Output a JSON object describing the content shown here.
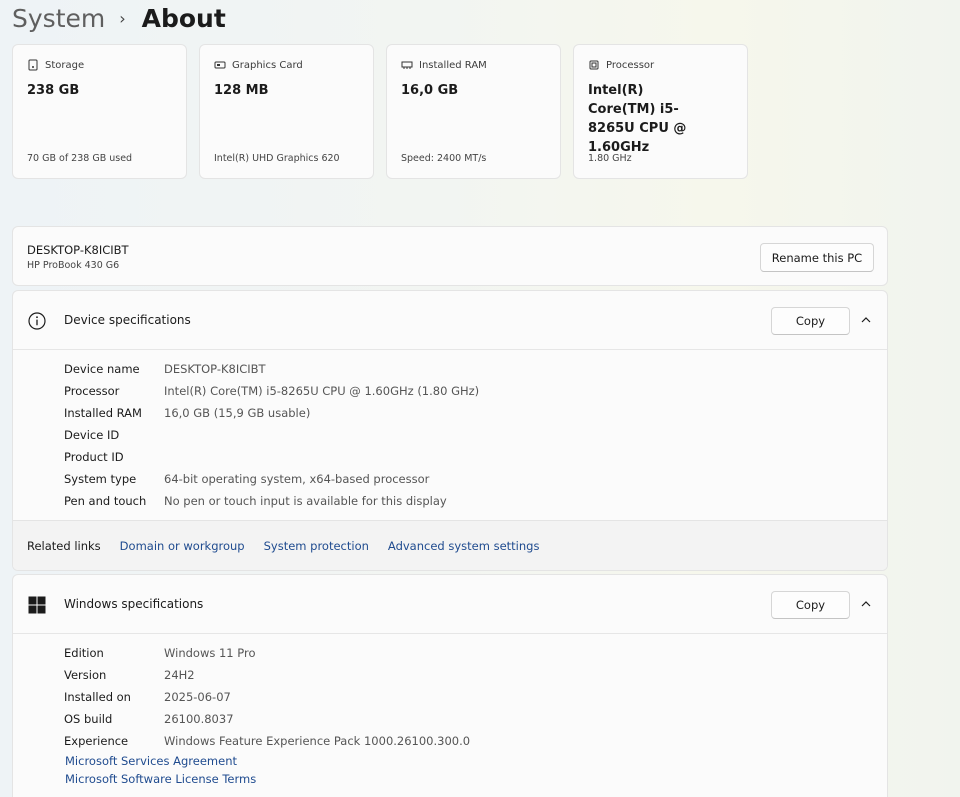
{
  "breadcrumb": {
    "parent": "System",
    "separator": "›",
    "current": "About"
  },
  "cards": [
    {
      "icon": "storage-icon",
      "label": "Storage",
      "value": "238 GB",
      "sub": "70 GB of 238 GB used"
    },
    {
      "icon": "graphics-card-icon",
      "label": "Graphics Card",
      "value": "128 MB",
      "sub": "Intel(R) UHD Graphics 620"
    },
    {
      "icon": "ram-icon",
      "label": "Installed RAM",
      "value": "16,0 GB",
      "sub": "Speed: 2400 MT/s"
    },
    {
      "icon": "processor-icon",
      "label": "Processor",
      "value": "Intel(R) Core(TM) i5-8265U CPU @ 1.60GHz",
      "sub": "1.80 GHz"
    }
  ],
  "pc": {
    "name": "DESKTOP-K8ICIBT",
    "model": "HP ProBook 430 G6",
    "rename_label": "Rename this PC"
  },
  "device_specs": {
    "title": "Device specifications",
    "copy_label": "Copy",
    "rows": [
      {
        "label": "Device name",
        "value": "DESKTOP-K8ICIBT"
      },
      {
        "label": "Processor",
        "value": "Intel(R) Core(TM) i5-8265U CPU @ 1.60GHz (1.80 GHz)"
      },
      {
        "label": "Installed RAM",
        "value": "16,0 GB (15,9 GB usable)"
      },
      {
        "label": "Device ID",
        "value": ""
      },
      {
        "label": "Product ID",
        "value": ""
      },
      {
        "label": "System type",
        "value": "64-bit operating system, x64-based processor"
      },
      {
        "label": "Pen and touch",
        "value": "No pen or touch input is available for this display"
      }
    ]
  },
  "related": {
    "label": "Related links",
    "links": [
      "Domain or workgroup",
      "System protection",
      "Advanced system settings"
    ]
  },
  "windows_specs": {
    "title": "Windows specifications",
    "copy_label": "Copy",
    "rows": [
      {
        "label": "Edition",
        "value": "Windows 11 Pro"
      },
      {
        "label": "Version",
        "value": "24H2"
      },
      {
        "label": "Installed on",
        "value": "2025-06-07"
      },
      {
        "label": "OS build",
        "value": "26100.8037"
      },
      {
        "label": "Experience",
        "value": "Windows Feature Experience Pack 1000.26100.300.0"
      }
    ],
    "links": [
      "Microsoft Services Agreement",
      "Microsoft Software License Terms"
    ]
  }
}
